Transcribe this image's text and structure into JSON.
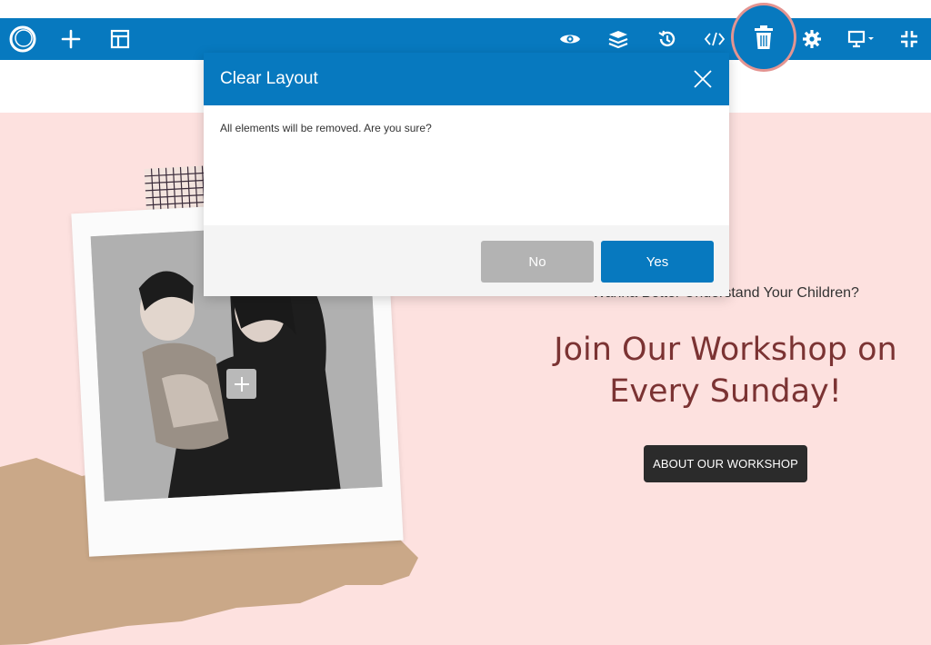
{
  "toolbar": {
    "left_icons": [
      "logo-ring-icon",
      "plus-icon",
      "layout-template-icon"
    ],
    "right_icons": [
      "preview-eye-icon",
      "layers-icon",
      "history-icon",
      "code-icon",
      "trash-icon",
      "settings-gear-icon",
      "desktop-device-icon",
      "collapse-arrows-icon"
    ],
    "highlight_color": "#e39491"
  },
  "dialog": {
    "title": "Clear Layout",
    "message": "All elements will be removed. Are you sure?",
    "no_label": "No",
    "yes_label": "Yes"
  },
  "page": {
    "subtitle": "Wanna Better Understand Your Children?",
    "headline_line1": "Join Our Workshop on",
    "headline_line2": "Every Sunday!",
    "cta_label": "ABOUT OUR WORKSHOP"
  },
  "colors": {
    "toolbar_blue": "#0779bf",
    "hero_background": "#fde1df",
    "headline": "#7b3333",
    "cta_background": "#2b2b2b",
    "no_button": "#b3b3b3"
  }
}
